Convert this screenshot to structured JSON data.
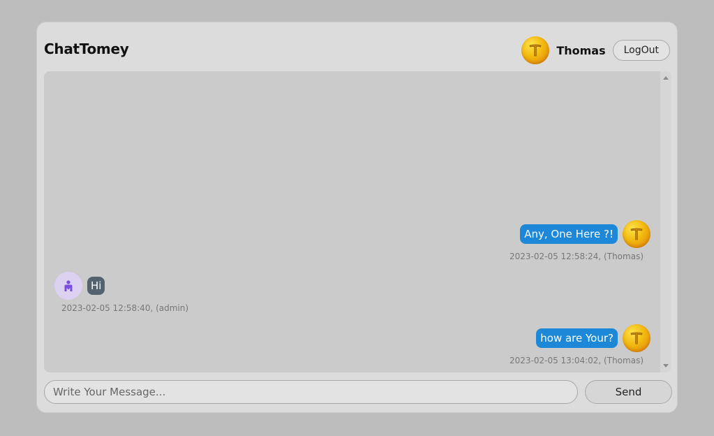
{
  "header": {
    "brand": "ChatTomey",
    "user": {
      "name": "Thomas",
      "avatar_icon": "letter-t-avatar-icon"
    },
    "logout_label": "LogOut"
  },
  "messages": [
    {
      "text": "Any, One Here ?!",
      "stamp": "2023-02-05 12:58:24, (Thomas)",
      "side": "right",
      "bubble_color": "#1e88d8"
    },
    {
      "text": "Hi",
      "stamp": "2023-02-05 12:58:40, (admin)",
      "side": "left",
      "bubble_color": "#546270",
      "avatar_icon": "admin-user-icon"
    },
    {
      "text": "how are Your?",
      "stamp": "2023-02-05 13:04:02, (Thomas)",
      "side": "right",
      "bubble_color": "#1e88d8"
    }
  ],
  "composer": {
    "placeholder": "Write Your Message...",
    "send_label": "Send"
  }
}
